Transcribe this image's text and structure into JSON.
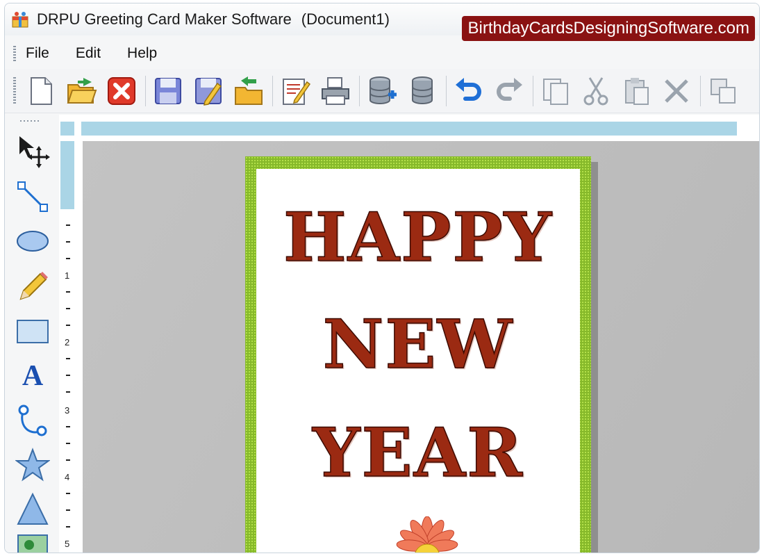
{
  "window": {
    "title": "DRPU Greeting Card Maker Software",
    "document": "(Document1)",
    "watermark": "BirthdayCardsDesigningSoftware.com"
  },
  "menu": {
    "items": [
      {
        "label": "File"
      },
      {
        "label": "Edit"
      },
      {
        "label": "Help"
      }
    ]
  },
  "toolbar": {
    "buttons": [
      "new-icon",
      "open-icon",
      "close-icon",
      "save-icon",
      "save-as-icon",
      "export-icon",
      "edit-document-icon",
      "print-icon",
      "database-add-icon",
      "database-icon",
      "undo-icon",
      "redo-icon",
      "copy-icon",
      "cut-icon",
      "paste-icon",
      "delete-icon",
      "duplicate-icon"
    ]
  },
  "tools": {
    "items": [
      "select-move-icon",
      "line-icon",
      "ellipse-icon",
      "pencil-icon",
      "rectangle-icon",
      "text-icon",
      "arc-icon",
      "star-icon",
      "triangle-icon",
      "image-icon"
    ],
    "text_tool_glyph": "A"
  },
  "ruler": {
    "left_numbers": [
      "1",
      "2",
      "3",
      "4",
      "5"
    ]
  },
  "card": {
    "line1": "HAPPY",
    "line2": "NEW",
    "line3": "YEAR",
    "border_color": "#86b92a",
    "text_color": "#9b2a12"
  }
}
